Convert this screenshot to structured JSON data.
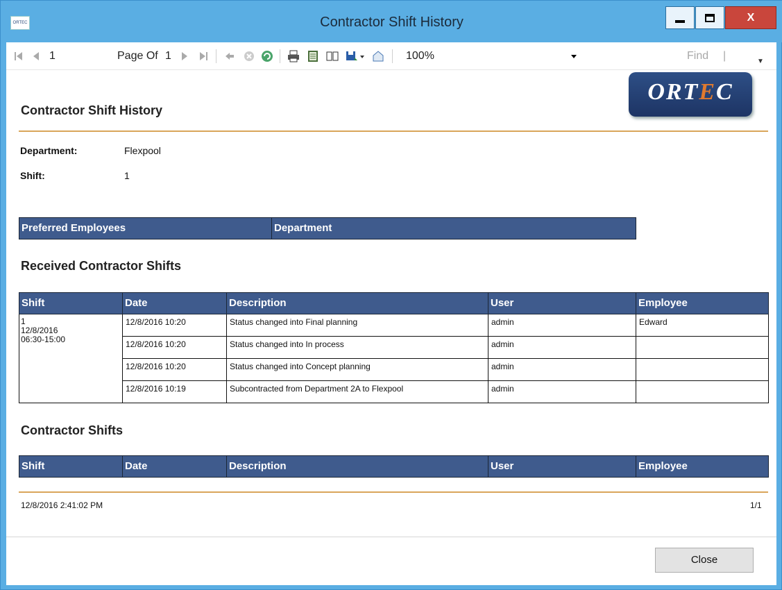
{
  "window": {
    "title": "Contractor Shift History",
    "app_icon_text": "ORTEC",
    "close_glyph": "X"
  },
  "toolbar": {
    "current_page": "1",
    "page_of_label": "Page Of",
    "total_pages": "1",
    "zoom": "100%",
    "find_label": "Find",
    "find_separator": "|",
    "more_glyph": "▼"
  },
  "report": {
    "logo_text": "ORTEC",
    "title": "Contractor Shift History",
    "department_label": "Department:",
    "department_value": "Flexpool",
    "shift_label": "Shift:",
    "shift_value": "1",
    "preferred_table": {
      "columns": [
        "Preferred Employees",
        "Department"
      ]
    },
    "received_section_title": "Received Contractor Shifts",
    "received_table": {
      "columns": [
        "Shift",
        "Date",
        "Description",
        "User",
        "Employee"
      ],
      "shift_block": [
        "1",
        "12/8/2016",
        "06:30-15:00"
      ],
      "rows": [
        {
          "date": "12/8/2016  10:20",
          "description": "Status changed into Final planning",
          "user": "admin",
          "employee": "Edward"
        },
        {
          "date": "12/8/2016  10:20",
          "description": "Status changed into In process",
          "user": "admin",
          "employee": ""
        },
        {
          "date": "12/8/2016  10:20",
          "description": "Status changed into Concept planning",
          "user": "admin",
          "employee": ""
        },
        {
          "date": "12/8/2016  10:19",
          "description": "Subcontracted from Department 2A to Flexpool",
          "user": "admin",
          "employee": ""
        }
      ]
    },
    "contractor_section_title": "Contractor Shifts",
    "contractor_table": {
      "columns": [
        "Shift",
        "Date",
        "Description",
        "User",
        "Employee"
      ]
    },
    "footer_timestamp": "12/8/2016 2:41:02 PM",
    "footer_page": "1/1"
  },
  "buttons": {
    "close": "Close"
  },
  "colors": {
    "title_bar": "#5aaee3",
    "table_header": "#3f5b8d",
    "rule": "#d9a55a",
    "logo": "#1d3464",
    "logo_accent": "#e07a2e"
  }
}
